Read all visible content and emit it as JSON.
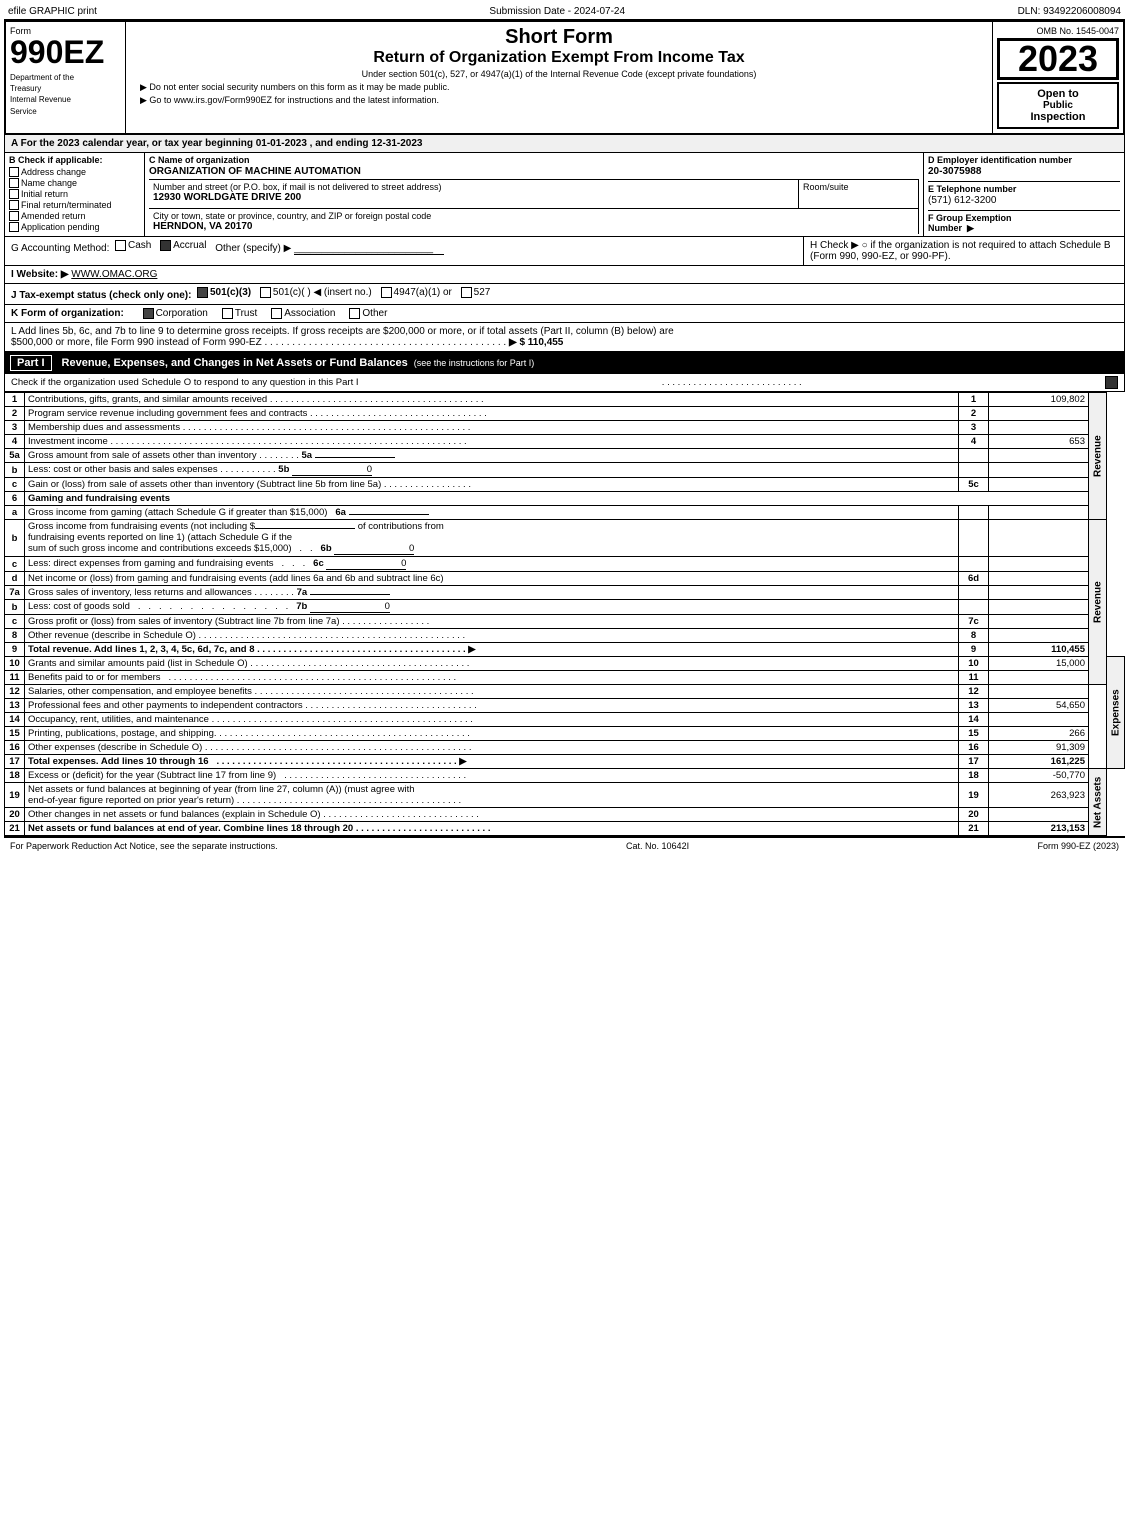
{
  "topbar": {
    "left": "efile GRAPHIC print",
    "center": "Submission Date - 2024-07-24",
    "right": "DLN: 93492206008094"
  },
  "form": {
    "number": "990EZ",
    "dept1": "Department of the",
    "dept2": "Treasury",
    "dept3": "Internal Revenue",
    "dept4": "Service"
  },
  "title": {
    "short_form": "Short Form",
    "return_title": "Return of Organization Exempt From Income Tax",
    "under_section": "Under section 501(c), 527, or 4947(a)(1) of the Internal Revenue Code (except private foundations)",
    "dont_enter": "▶ Do not enter social security numbers on this form as it may be made public.",
    "go_to": "▶ Go to www.irs.gov/Form990EZ for instructions and the latest information."
  },
  "omb": {
    "number": "OMB No. 1545-0047",
    "year": "2023",
    "open_line1": "Open to",
    "open_line2": "Public",
    "open_line3": "Inspection"
  },
  "section_a": {
    "label": "A  For the 2023 calendar year, or tax year beginning  01-01-2023 , and ending  12-31-2023"
  },
  "field_b": {
    "label": "B  Check if applicable:",
    "items": [
      {
        "label": "Address change",
        "checked": false
      },
      {
        "label": "Name change",
        "checked": false
      },
      {
        "label": "Initial return",
        "checked": false
      },
      {
        "label": "Final return/terminated",
        "checked": false
      },
      {
        "label": "Amended return",
        "checked": false
      },
      {
        "label": "Application pending",
        "checked": false
      }
    ]
  },
  "field_c": {
    "label": "C Name of organization",
    "value": "ORGANIZATION OF MACHINE AUTOMATION",
    "address_label": "Number and street (or P.O. box, if mail is not delivered to street address)",
    "address_value": "12930 WORLDGATE DRIVE 200",
    "room_label": "Room/suite",
    "room_value": "",
    "city_label": "City or town, state or province, country, and ZIP or foreign postal code",
    "city_value": "HERNDON, VA  20170"
  },
  "field_d": {
    "label": "D Employer identification number",
    "value": "20-3075988",
    "phone_label": "E Telephone number",
    "phone_value": "(571) 612-3200",
    "fgroup_label": "F Group Exemption Number",
    "fgroup_arrow": "▶"
  },
  "accounting": {
    "prefix": "G Accounting Method:",
    "cash_label": "Cash",
    "accrual_label": "Accrual",
    "accrual_checked": true,
    "other_label": "Other (specify) ▶",
    "other_value": "_________________________"
  },
  "h_box": {
    "text": "H  Check ▶  ○ if the organization is not required to attach Schedule B (Form 990, 990-EZ, or 990-PF)."
  },
  "website": {
    "prefix": "I Website: ▶",
    "value": "WWW.OMAC.ORG"
  },
  "tax_status": {
    "prefix": "J Tax-exempt status (check only one):",
    "options": [
      {
        "label": "501(c)(3)",
        "checked": true
      },
      {
        "label": "501(c)(   ) ◀ (insert no.)",
        "checked": false
      },
      {
        "label": "4947(a)(1) or",
        "checked": false
      },
      {
        "label": "527",
        "checked": false
      }
    ]
  },
  "k_row": {
    "prefix": "K Form of organization:",
    "options": [
      {
        "label": "Corporation",
        "checked": true
      },
      {
        "label": "Trust",
        "checked": false
      },
      {
        "label": "Association",
        "checked": false
      },
      {
        "label": "Other",
        "checked": false
      }
    ]
  },
  "l_row": {
    "text1": "L Add lines 5b, 6c, and 7b to line 9 to determine gross receipts. If gross receipts are $200,000 or more, or if total assets (Part II, column (B) below) are",
    "text2": "$500,000 or more, file Form 990 instead of Form 990-EZ",
    "dots": ". . . . . . . . . . . . . . . . . . . . . . . . . . . . . . . . . . . . . . . . . . . .",
    "arrow": "▶ $ 110,455"
  },
  "part1": {
    "label": "Part I",
    "title": "Revenue, Expenses, and Changes in Net Assets or Fund Balances",
    "see_instructions": "(see the instructions for Part I)",
    "check_schedule": "Check if the organization used Schedule O to respond to any question in this Part I",
    "check_dots": ". . . . . . . . . . . . . . . . . . . . . . . . . . . .",
    "check_box": "☑"
  },
  "revenue_lines": [
    {
      "num": "1",
      "desc": "Contributions, gifts, grants, and similar amounts received",
      "dots": true,
      "line_ref": "1",
      "amount": "109,802"
    },
    {
      "num": "2",
      "desc": "Program service revenue including government fees and contracts",
      "dots": true,
      "line_ref": "2",
      "amount": ""
    },
    {
      "num": "3",
      "desc": "Membership dues and assessments",
      "dots": true,
      "line_ref": "3",
      "amount": ""
    },
    {
      "num": "4",
      "desc": "Investment income",
      "dots": true,
      "line_ref": "4",
      "amount": "653"
    },
    {
      "num": "5a",
      "desc": "Gross amount from sale of assets other than inventory",
      "sub_label": "5a",
      "sub_amount": "",
      "dots": false
    },
    {
      "num": "b",
      "desc": "Less: cost or other basis and sales expenses",
      "sub_label": "5b",
      "sub_amount": "0",
      "dots": false
    },
    {
      "num": "c",
      "desc": "Gain or (loss) from sale of assets other than inventory (Subtract line 5b from line 5a)",
      "dots": true,
      "line_ref": "5c",
      "amount": ""
    },
    {
      "num": "6",
      "desc": "Gaming and fundraising events",
      "dots": false
    },
    {
      "num": "a",
      "desc": "Gross income from gaming (attach Schedule G if greater than $15,000)",
      "sub_label": "6a",
      "sub_amount": "",
      "dots": false
    },
    {
      "num": "b",
      "desc": "Gross income from fundraising events (not including $_______________  of contributions from fundraising events reported on line 1) (attach Schedule G if the sum of such gross income and contributions exceeds $15,000)",
      "sub_label": "6b",
      "sub_amount": "0",
      "dots": false
    },
    {
      "num": "c",
      "desc": "Less: direct expenses from gaming and fundraising events",
      "sub_label": "6c",
      "sub_amount": "0",
      "dots": false
    },
    {
      "num": "d",
      "desc": "Net income or (loss) from gaming and fundraising events (add lines 6a and 6b and subtract line 6c)",
      "dots": false,
      "line_ref": "6d",
      "amount": ""
    },
    {
      "num": "7a",
      "desc": "Gross sales of inventory, less returns and allowances",
      "sub_label": "7a",
      "sub_amount": "",
      "dots": false
    },
    {
      "num": "b",
      "desc": "Less: cost of goods sold",
      "sub_label": "7b",
      "sub_amount": "0",
      "dots": false
    },
    {
      "num": "c",
      "desc": "Gross profit or (loss) from sales of inventory (Subtract line 7b from line 7a)",
      "dots": true,
      "line_ref": "7c",
      "amount": ""
    },
    {
      "num": "8",
      "desc": "Other revenue (describe in Schedule O)",
      "dots": true,
      "line_ref": "8",
      "amount": ""
    },
    {
      "num": "9",
      "desc": "Total revenue. Add lines 1, 2, 3, 4, 5c, 6d, 7c, and 8",
      "dots": true,
      "arrow": "▶",
      "line_ref": "9",
      "amount": "110,455",
      "bold": true
    }
  ],
  "expense_lines": [
    {
      "num": "10",
      "desc": "Grants and similar amounts paid (list in Schedule O)",
      "dots": true,
      "line_ref": "10",
      "amount": "15,000"
    },
    {
      "num": "11",
      "desc": "Benefits paid to or for members",
      "dots": true,
      "line_ref": "11",
      "amount": ""
    },
    {
      "num": "12",
      "desc": "Salaries, other compensation, and employee benefits",
      "dots": true,
      "line_ref": "12",
      "amount": ""
    },
    {
      "num": "13",
      "desc": "Professional fees and other payments to independent contractors",
      "dots": true,
      "line_ref": "13",
      "amount": "54,650"
    },
    {
      "num": "14",
      "desc": "Occupancy, rent, utilities, and maintenance",
      "dots": true,
      "line_ref": "14",
      "amount": ""
    },
    {
      "num": "15",
      "desc": "Printing, publications, postage, and shipping",
      "dots": true,
      "line_ref": "15",
      "amount": "266"
    },
    {
      "num": "16",
      "desc": "Other expenses (describe in Schedule O)",
      "dots": true,
      "line_ref": "16",
      "amount": "91,309"
    },
    {
      "num": "17",
      "desc": "Total expenses. Add lines 10 through 16",
      "dots": true,
      "arrow": "▶",
      "line_ref": "17",
      "amount": "161,225",
      "bold": true
    }
  ],
  "net_assets_lines": [
    {
      "num": "18",
      "desc": "Excess or (deficit) for the year (Subtract line 17 from line 9)",
      "dots": true,
      "line_ref": "18",
      "amount": "-50,770"
    },
    {
      "num": "19",
      "desc": "Net assets or fund balances at beginning of year (from line 27, column (A)) (must agree with end-of-year figure reported on prior year's return)",
      "dots": true,
      "line_ref": "19",
      "amount": "263,923"
    },
    {
      "num": "20",
      "desc": "Other changes in net assets or fund balances (explain in Schedule O)",
      "dots": true,
      "line_ref": "20",
      "amount": ""
    },
    {
      "num": "21",
      "desc": "Net assets or fund balances at end of year. Combine lines 18 through 20",
      "dots": true,
      "line_ref": "21",
      "amount": "213,153",
      "bold": true
    }
  ],
  "footer": {
    "left": "For Paperwork Reduction Act Notice, see the separate instructions.",
    "center": "Cat. No. 10642I",
    "right": "Form 990-EZ (2023)"
  }
}
